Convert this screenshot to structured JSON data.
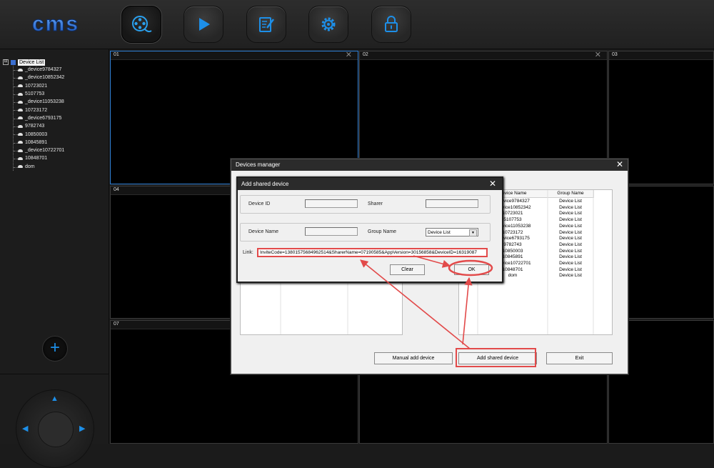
{
  "app": {
    "logo_text": "cms"
  },
  "toolbar": {
    "buttons": [
      {
        "name": "preview",
        "icon": "film-reel-icon"
      },
      {
        "name": "playback",
        "icon": "play-icon"
      },
      {
        "name": "log",
        "icon": "notepad-icon"
      },
      {
        "name": "settings",
        "icon": "gear-icon"
      },
      {
        "name": "lock",
        "icon": "lock-icon"
      }
    ]
  },
  "device_tree": {
    "root_label": "Device List",
    "expander": "⊟",
    "items": [
      "_device9784327",
      "_device10852342",
      "10723021",
      "5107753",
      "_device11053238",
      "10723172",
      "_device6793175",
      "9782743",
      "10850003",
      "10845891",
      "_device10722701",
      "10848701",
      "dom"
    ]
  },
  "left_panel": {
    "add_label": "+",
    "ptz": {
      "up": "▲",
      "left": "◀",
      "right": "▶"
    }
  },
  "video_grid": {
    "cells": [
      {
        "num": "01",
        "close": "✕"
      },
      {
        "num": "02",
        "close": "✕"
      },
      {
        "num": "03",
        "close": ""
      },
      {
        "num": "04",
        "close": ""
      },
      {
        "num": "07",
        "close": ""
      }
    ]
  },
  "devices_manager": {
    "title": "Devices manager",
    "close": "✕",
    "columns": [
      "Device Name",
      "Group Name"
    ],
    "rows": [
      {
        "device": "_device9784327",
        "group": "Device List"
      },
      {
        "device": "_device10852342",
        "group": "Device List"
      },
      {
        "device": "10723021",
        "group": "Device List"
      },
      {
        "device": "5107753",
        "group": "Device List"
      },
      {
        "device": "_device11053238",
        "group": "Device List"
      },
      {
        "device": "10723172",
        "group": "Device List"
      },
      {
        "device": "_device6793175",
        "group": "Device List"
      },
      {
        "device": "9782743",
        "group": "Device List"
      },
      {
        "device": "10850003",
        "group": "Device List"
      },
      {
        "device": "10845891",
        "group": "Device List"
      },
      {
        "device": "_device10722701",
        "group": "Device List"
      },
      {
        "device": "10848701",
        "group": "Device List"
      },
      {
        "device": "dom",
        "group": "Device List"
      }
    ],
    "buttons": {
      "manual_add": "Manual add device",
      "add_shared": "Add shared device",
      "exit": "Exit"
    }
  },
  "add_shared_device": {
    "title": "Add shared device",
    "close": "✕",
    "device_id_label": "Device ID",
    "device_id_value": "",
    "sharer_label": "Sharer",
    "sharer_value": "",
    "device_name_label": "Device Name",
    "device_name_value": "",
    "group_name_label": "Group Name",
    "group_name_value": "Device List",
    "combo_arrow": "▼",
    "link_label": "Link:",
    "link_value": "InviteCode=13801575684962514&SharerName=07190585&AppVersion=30156858&DeviceID=16319087",
    "clear_label": "Clear",
    "ok_label": "OK"
  },
  "colors": {
    "accent_blue": "#1d8fe8",
    "annotation_red": "#e24a4a"
  }
}
